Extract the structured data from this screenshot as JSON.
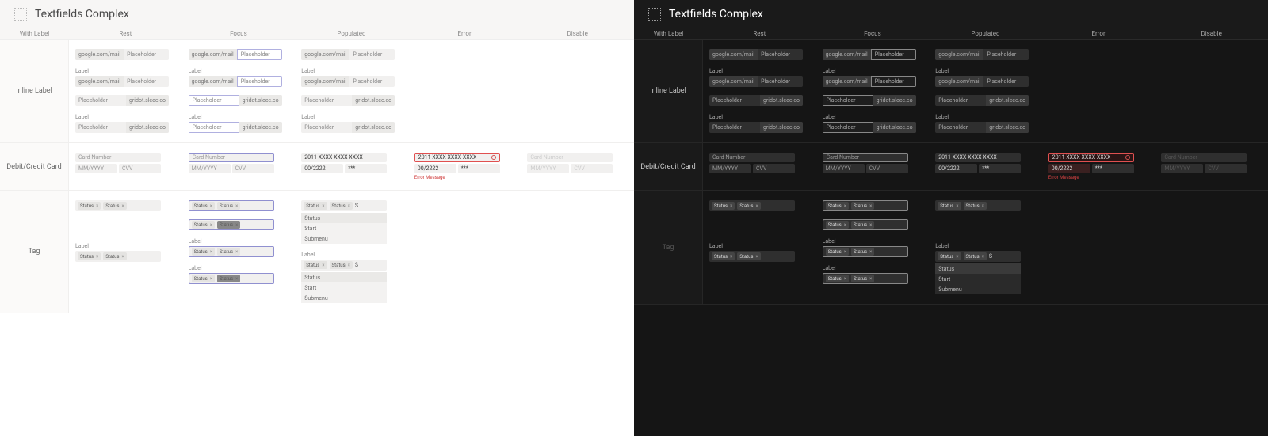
{
  "title": "Textfields Complex",
  "columns": [
    "With Label",
    "Rest",
    "Focus",
    "Populated",
    "Error",
    "Disable"
  ],
  "sections": {
    "inline": "Inline Label",
    "card": "Debit/Credit Card",
    "tag": "Tag"
  },
  "field": {
    "label": "Label",
    "prefix": "google.com/mail",
    "suffix": "gridot.sleec.co",
    "placeholder": "Placeholder"
  },
  "card": {
    "num_ph": "Card Number",
    "num_val": "2011 XXXX XXXX XXXX",
    "exp_ph": "MM/YYYY",
    "exp_val": "00/2222",
    "cvv_ph": "CVV",
    "cvv_val": "***",
    "error": "Error Message"
  },
  "tag": {
    "chip": "Status",
    "x": "×",
    "cursor": "S",
    "label": "Label",
    "dd": [
      "Status",
      "Start",
      "Submenu"
    ]
  },
  "chart_data": null
}
